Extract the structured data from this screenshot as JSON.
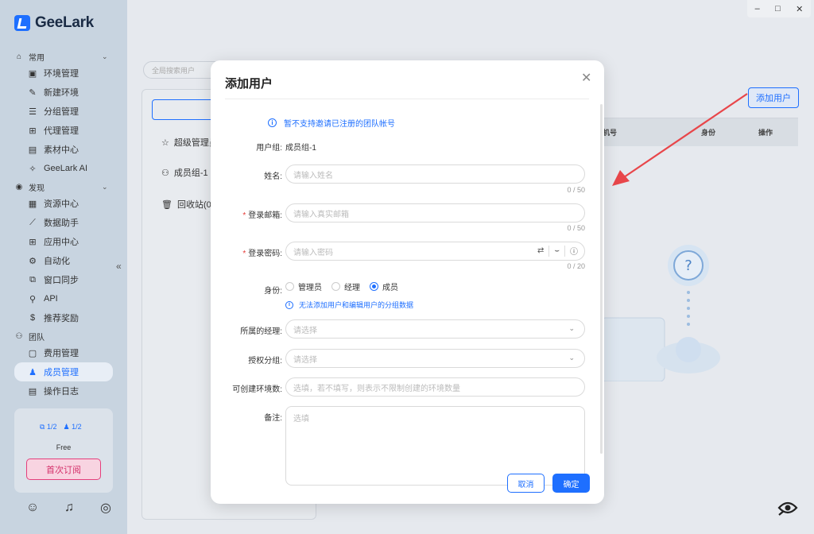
{
  "app": {
    "name": "GeeLark"
  },
  "window": {
    "minimize": "–",
    "maximize": "□",
    "close": "✕"
  },
  "sidebar": {
    "groups": [
      {
        "label": "常用",
        "items": [
          "环境管理",
          "新建环境",
          "分组管理",
          "代理管理",
          "素材中心",
          "GeeLark AI"
        ]
      },
      {
        "label": "发现",
        "items": [
          "资源中心",
          "数据助手",
          "应用中心",
          "自动化",
          "窗口同步",
          "API",
          "推荐奖励"
        ]
      },
      {
        "label": "团队",
        "items": [
          "费用管理",
          "成员管理",
          "操作日志"
        ]
      }
    ],
    "active_item": "成员管理",
    "collapse_glyph": "«",
    "plan": {
      "env_usage": "1/2",
      "member_usage": "1/2",
      "name": "Free",
      "subscribe_label": "首次订阅"
    }
  },
  "main": {
    "search_placeholder": "全局搜索用户",
    "groups": [
      {
        "label": "超级管理员"
      },
      {
        "label": "成员组-1"
      },
      {
        "label": "回收站(0)"
      }
    ],
    "add_user_label": "添加用户",
    "table_headers": [
      "机号",
      "身份",
      "操作"
    ]
  },
  "modal": {
    "title": "添加用户",
    "notice": "暂不支持邀请已注册的团队帐号",
    "user_group_label": "用户组:",
    "user_group_value": "成员组-1",
    "name_label": "姓名:",
    "name_placeholder": "请输入姓名",
    "name_counter": "0 / 50",
    "email_label": "登录邮箱:",
    "email_placeholder": "请输入真实邮箱",
    "email_counter": "0 / 50",
    "password_label": "登录密码:",
    "password_placeholder": "请输入密码",
    "password_counter": "0 / 20",
    "role_label": "身份:",
    "roles": [
      "管理员",
      "经理",
      "成员"
    ],
    "selected_role": "成员",
    "role_tip": "无法添加用户和编辑用户的分组数据",
    "manager_label": "所属的经理:",
    "manager_placeholder": "请选择",
    "group_auth_label": "授权分组:",
    "group_auth_placeholder": "请选择",
    "env_limit_label": "可创建环境数:",
    "env_limit_placeholder": "选填，若不填写，则表示不限制创建的环境数量",
    "remark_label": "备注:",
    "remark_placeholder": "选填",
    "cancel_label": "取消",
    "confirm_label": "确定"
  },
  "colors": {
    "accent": "#1e6fff",
    "danger": "#e53935",
    "subscribe": "#e53f7c",
    "arrow": "#e8464a"
  }
}
